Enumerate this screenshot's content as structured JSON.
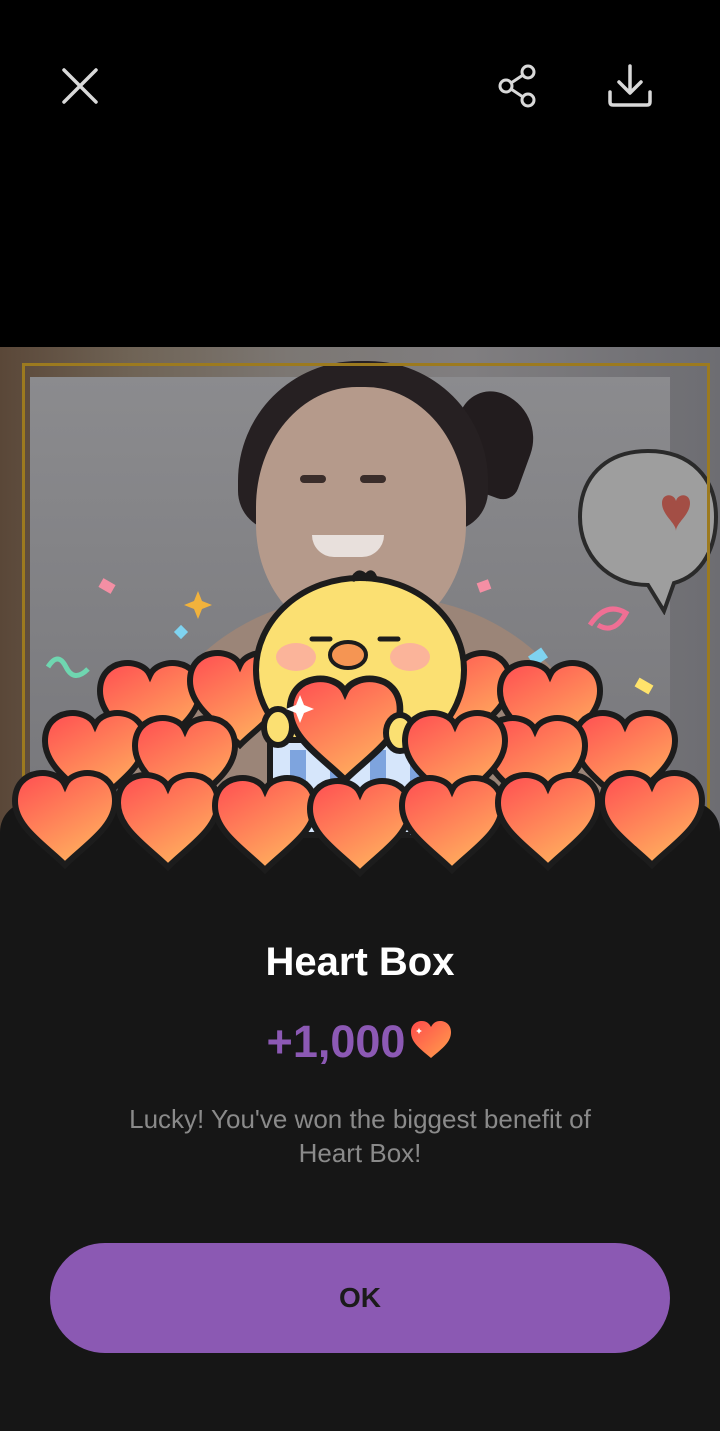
{
  "top_bar": {
    "close_icon": "close-icon",
    "share_icon": "share-icon",
    "download_icon": "download-icon"
  },
  "reward_sheet": {
    "title": "Heart Box",
    "amount": "+1,000",
    "heart_icon": "heart-icon",
    "message": "Lucky! You've won the biggest benefit of Heart Box!",
    "ok_label": "OK"
  },
  "colors": {
    "accent": "#8b59b3",
    "amount_text": "#8c59b4",
    "sheet_background": "#161616",
    "heart_orange": "#ff6b3d"
  }
}
